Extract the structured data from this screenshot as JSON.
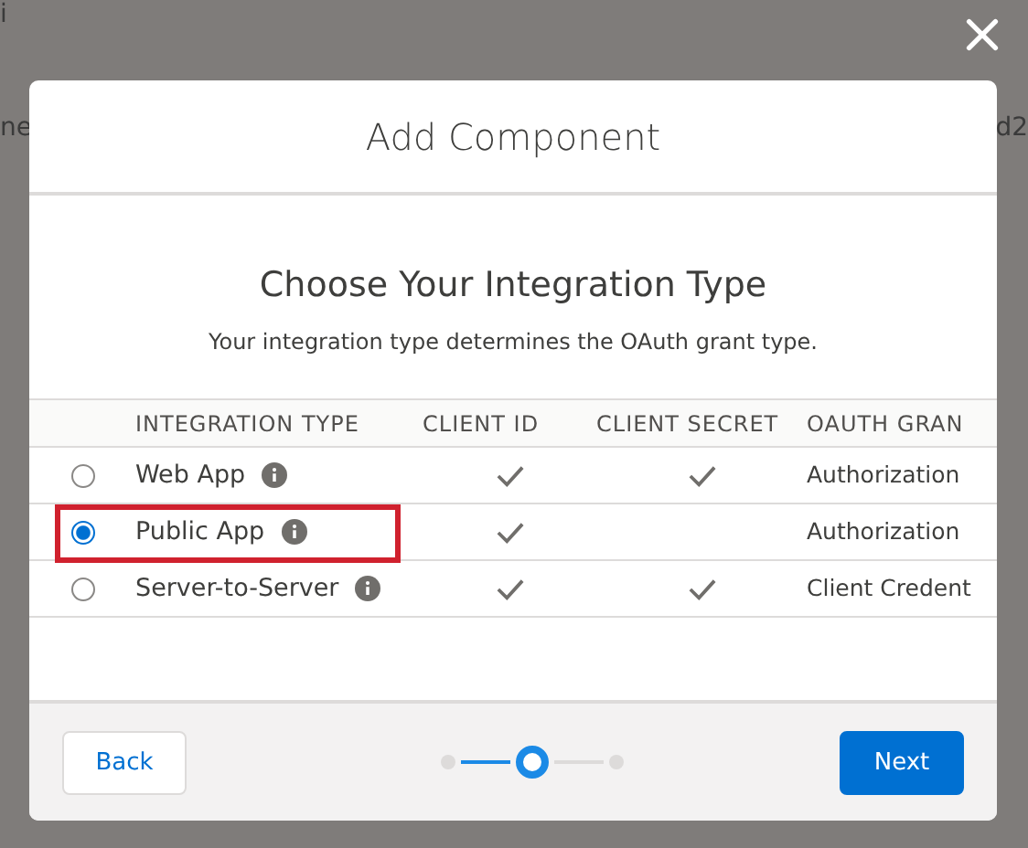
{
  "backdrop": {
    "fragments": [
      {
        "text": "i",
        "kind": "top"
      },
      {
        "text": "ne",
        "kind": "left"
      },
      {
        "text": "d2",
        "kind": "right"
      }
    ]
  },
  "modal": {
    "title": "Add Component",
    "heading": "Choose Your Integration Type",
    "description": "Your integration type determines the OAuth grant type.",
    "table": {
      "columns": [
        "INTEGRATION TYPE",
        "CLIENT ID",
        "CLIENT SECRET",
        "OAUTH GRAN"
      ],
      "rows": [
        {
          "label": "Web App",
          "selected": false,
          "client_id": true,
          "client_secret": true,
          "grant": "Authorization"
        },
        {
          "label": "Public App",
          "selected": true,
          "client_id": true,
          "client_secret": false,
          "grant": "Authorization"
        },
        {
          "label": "Server-to-Server",
          "selected": false,
          "client_id": true,
          "client_secret": true,
          "grant": "Client Credent"
        }
      ]
    },
    "steps": [
      {
        "selected": false
      },
      {
        "selected": true
      },
      {
        "selected": false
      }
    ],
    "buttons": [
      {
        "label": "Back",
        "kind": "neutral"
      },
      {
        "label": "Next",
        "kind": "brand"
      }
    ]
  }
}
